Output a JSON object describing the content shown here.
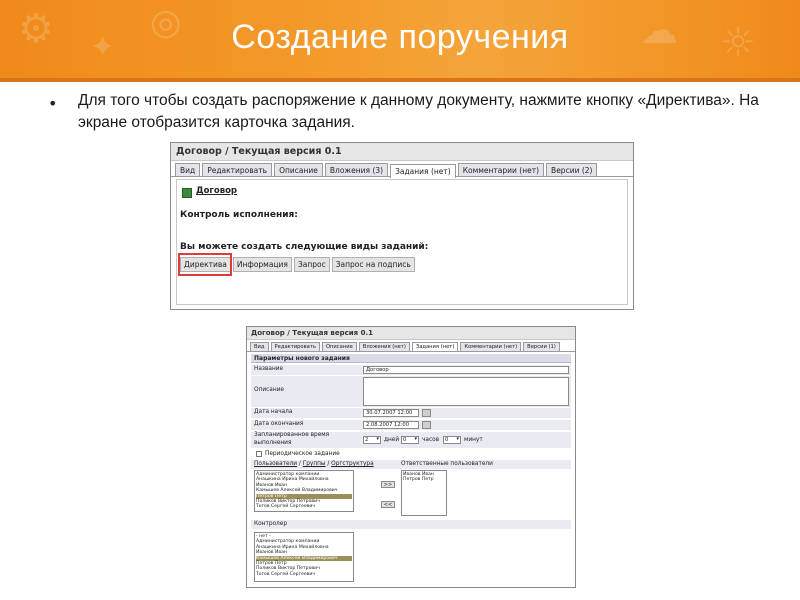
{
  "slide": {
    "title": "Создание поручения",
    "bullet": "Для того чтобы создать распоряжение к данному документу, нажмите кнопку «Директива». На экране отобразится карточка задания."
  },
  "colors": {
    "banner": "#f08a1a",
    "highlight": "#e03a3a",
    "selected_row": "#9b8f5a"
  },
  "screen1": {
    "window_title": "Договор / Текущая версия 0.1",
    "tabs": [
      "Вид",
      "Редактировать",
      "Описание",
      "Вложения (3)",
      "Задания (нет)",
      "Комментарии (нет)",
      "Версии (2)"
    ],
    "active_tab": "Задания (нет)",
    "doc_link": "Договор",
    "control_label": "Контроль исполнения:",
    "create_label": "Вы можете создать следующие виды заданий:",
    "task_buttons": [
      "Директива",
      "Информация",
      "Запрос",
      "Запрос на подпись"
    ]
  },
  "screen2": {
    "window_title": "Договор / Текущая версия 0.1",
    "tabs": [
      "Вид",
      "Редактировать",
      "Описание",
      "Вложения (нет)",
      "Задания (нет)",
      "Комментарии (нет)",
      "Версии (1)"
    ],
    "params_header": "Параметры нового задания",
    "name_label": "Название",
    "name_value": "Договор",
    "description_label": "Описание",
    "start_label": "Дата начала",
    "start_value": "30.07.2007 12:00",
    "end_label": "Дата окончания",
    "end_value": "2.08.2007 12:00",
    "planned_label_1": "Запланированное время",
    "planned_label_2": "выполнения",
    "days_value": "2",
    "days_label": "дней",
    "hours_value": "0",
    "hours_label": "часов",
    "minutes_value": "0",
    "minutes_label": "минут",
    "periodic_label": "Периодическое задание",
    "users_link": "Пользователи",
    "groups_link": "Группы",
    "orgstructure_link": "Оргструктура",
    "responsible_label": "Ответственные пользователи",
    "users": [
      "Администратор компании",
      "Анашкина Ирина Михайловна",
      "Иванов Иван",
      "Камышев Алексей Владимирович",
      "Петров Петр",
      "Поликов Виктор Петрович",
      "Тогов Сергей Сергеевич"
    ],
    "responsible_users": [
      "Иванов Иван",
      "Петров Петр"
    ],
    "add_arrow": ">>",
    "remove_arrow": "<<",
    "controller_label": "Контролер",
    "controllers": [
      "- нет -",
      "Администратор компании",
      "Анашкина Ирина Михайловна",
      "Иванов Иван",
      "Камышев Алексей Владимирович",
      "Петров Петр",
      "Поликов Виктор Петрович",
      "Тогов Сергей Сергеевич"
    ]
  }
}
